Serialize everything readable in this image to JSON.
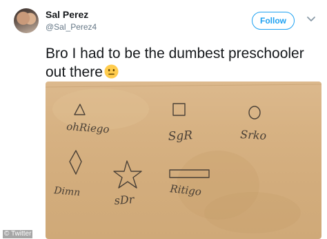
{
  "tweet": {
    "display_name": "Sal Perez",
    "handle": "@Sal_Perez4",
    "follow_label": "Follow",
    "text_lines": [
      "Bro I had to be the dumbest preschooler",
      "out there"
    ],
    "emoji": "neutral-face-emoji"
  },
  "photo": {
    "description_icon": "handwritten-shapes-worksheet",
    "handwriting": {
      "triangle_label": "ohRiego",
      "square_label": "SgR",
      "circle_label": "Srko",
      "diamond_label": "Dimn",
      "star_label": "sDr",
      "rectangle_label": "Ritigo"
    }
  },
  "watermark": "© Twitter",
  "colors": {
    "accent": "#1da1f2",
    "text": "#14171a",
    "secondary": "#657786",
    "paper": "#d7b283",
    "pencil": "#4a4036"
  }
}
